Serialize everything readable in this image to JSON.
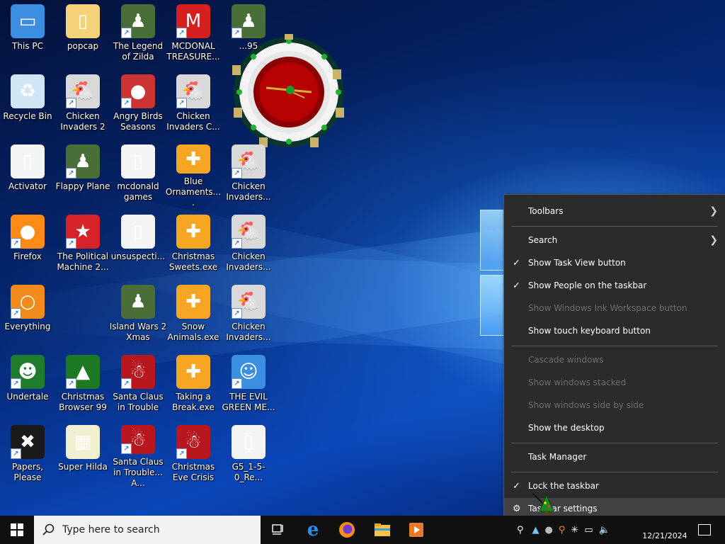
{
  "desktop_icons": [
    {
      "label": "This PC",
      "icon": "computer-icon",
      "shortcut": false
    },
    {
      "label": "popcap",
      "icon": "folder-icon",
      "shortcut": false
    },
    {
      "label": "The Legend of Zilda",
      "icon": "game-icon",
      "shortcut": true
    },
    {
      "label": "MCDONAL TREASURE...",
      "icon": "mcdonalds-icon",
      "shortcut": true
    },
    {
      "label": "...95",
      "icon": "game-icon",
      "shortcut": true
    },
    {
      "label": "Recycle Bin",
      "icon": "recycle-bin-icon",
      "shortcut": false
    },
    {
      "label": "Chicken Invaders 2",
      "icon": "chicken-icon",
      "shortcut": true
    },
    {
      "label": "Angry Birds Seasons",
      "icon": "angry-bird-icon",
      "shortcut": true
    },
    {
      "label": "Chicken Invaders C...",
      "icon": "chicken-icon",
      "shortcut": true
    },
    {
      "label": "Activator",
      "icon": "file-icon",
      "shortcut": false
    },
    {
      "label": "Flappy Plane",
      "icon": "game-icon",
      "shortcut": true
    },
    {
      "label": "mcdonald games",
      "icon": "file-icon",
      "shortcut": false
    },
    {
      "label": "Blue Ornaments....",
      "icon": "puzzle-icon",
      "shortcut": false
    },
    {
      "label": "Chicken Invaders...",
      "icon": "chicken-icon",
      "shortcut": true
    },
    {
      "label": "Firefox",
      "icon": "firefox-icon",
      "shortcut": true
    },
    {
      "label": "The Political Machine 2...",
      "icon": "badge-icon",
      "shortcut": true
    },
    {
      "label": "unsuspecti...",
      "icon": "file-icon",
      "shortcut": false
    },
    {
      "label": "Christmas Sweets.exe",
      "icon": "puzzle-icon",
      "shortcut": false
    },
    {
      "label": "Chicken Invaders...",
      "icon": "chicken-icon",
      "shortcut": true
    },
    {
      "label": "Everything",
      "icon": "search-ring-icon",
      "shortcut": true
    },
    {
      "label": "Island Wars 2 Xmas",
      "icon": "game-icon",
      "shortcut": false
    },
    {
      "label": "Snow Animals.exe",
      "icon": "puzzle-icon",
      "shortcut": false
    },
    {
      "label": "Chicken Invaders...",
      "icon": "chicken-icon",
      "shortcut": true
    },
    {
      "label": "Undertale",
      "icon": "undertale-icon",
      "shortcut": true
    },
    {
      "label": "Christmas Browser 99",
      "icon": "xmas-tree-icon",
      "shortcut": true
    },
    {
      "label": "Santa Claus in Trouble",
      "icon": "santa-icon",
      "shortcut": true
    },
    {
      "label": "Taking a Break.exe",
      "icon": "puzzle-icon",
      "shortcut": false
    },
    {
      "label": "THE EVIL GREEN ME...",
      "icon": "messenger-icon",
      "shortcut": true
    },
    {
      "label": "Papers, Please",
      "icon": "papers-icon",
      "shortcut": true
    },
    {
      "label": "Super Hilda",
      "icon": "pixel-icon",
      "shortcut": false
    },
    {
      "label": "Santa Claus in Trouble... A...",
      "icon": "santa-icon",
      "shortcut": true
    },
    {
      "label": "Christmas Eve Crisis",
      "icon": "santa-icon",
      "shortcut": true
    },
    {
      "label": "G5_1-5-0_Re...",
      "icon": "file-icon",
      "shortcut": false
    }
  ],
  "context_menu": {
    "items": [
      {
        "label": "Toolbars",
        "checked": false,
        "disabled": false,
        "submenu": true
      },
      {
        "label": "Search",
        "checked": false,
        "disabled": false,
        "submenu": true
      },
      {
        "label": "Show Task View button",
        "checked": true,
        "disabled": false,
        "submenu": false
      },
      {
        "label": "Show People on the taskbar",
        "checked": true,
        "disabled": false,
        "submenu": false
      },
      {
        "label": "Show Windows Ink Workspace button",
        "checked": false,
        "disabled": true,
        "submenu": false
      },
      {
        "label": "Show touch keyboard button",
        "checked": false,
        "disabled": false,
        "submenu": false
      },
      {
        "label": "Cascade windows",
        "checked": false,
        "disabled": true,
        "submenu": false
      },
      {
        "label": "Show windows stacked",
        "checked": false,
        "disabled": true,
        "submenu": false
      },
      {
        "label": "Show windows side by side",
        "checked": false,
        "disabled": true,
        "submenu": false
      },
      {
        "label": "Show the desktop",
        "checked": false,
        "disabled": false,
        "submenu": false
      },
      {
        "label": "Task Manager",
        "checked": false,
        "disabled": false,
        "submenu": false
      },
      {
        "label": "Lock the taskbar",
        "checked": true,
        "disabled": false,
        "submenu": false
      },
      {
        "label": "Taskbar settings",
        "checked": false,
        "disabled": false,
        "submenu": false,
        "icon": "gear-icon"
      }
    ]
  },
  "taskbar": {
    "search_placeholder": "Type here to search",
    "clock_date": "12/21/2024",
    "apps": [
      "task-view-icon",
      "edge-icon",
      "firefox-icon",
      "file-explorer-icon",
      "media-player-icon"
    ]
  },
  "colors": {
    "menu_bg": "#2b2b2b",
    "menu_disabled": "#6d6d6d",
    "taskbar_bg": "#101010"
  }
}
